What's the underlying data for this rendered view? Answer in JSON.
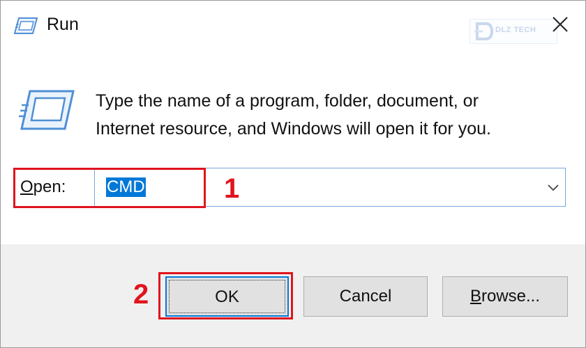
{
  "window": {
    "title": "Run"
  },
  "watermark": {
    "text": "DLZ TECH"
  },
  "description": {
    "line1": "Type the name of a program, folder, document, or",
    "line2": "Internet resource, and Windows will open it for you."
  },
  "open": {
    "label_accesskey": "O",
    "label_rest": "pen:",
    "value": "CMD"
  },
  "buttons": {
    "ok": "OK",
    "cancel": "Cancel",
    "browse_accesskey": "B",
    "browse_rest": "rowse..."
  },
  "annotations": {
    "step1": "1",
    "step2": "2",
    "color": "#e0141e"
  },
  "colors": {
    "accent": "#0078d7",
    "footer_bg": "#f0f0f0",
    "button_bg": "#e1e1e1"
  },
  "icons": [
    "run-icon",
    "close-icon",
    "chevron-down-icon",
    "watermark-logo-icon"
  ]
}
